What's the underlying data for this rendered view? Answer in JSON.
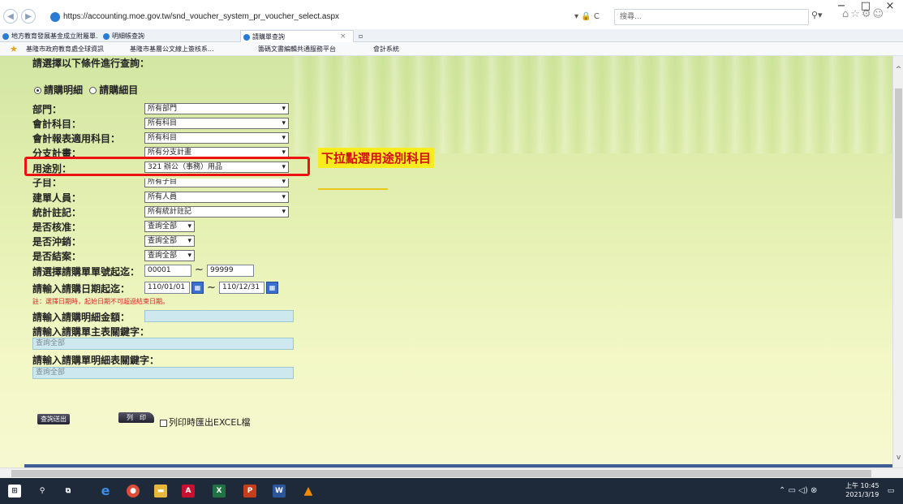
{
  "browser": {
    "url": "https://accounting.moe.gov.tw/snd_voucher_system_pr_voucher_select.aspx",
    "url_tools": "▾ 🔒 C",
    "search_placeholder": "搜尋...",
    "window_controls": [
      "−",
      "□",
      "×"
    ],
    "tabs": [
      {
        "label": "地方教育發展基金成立附屬單...",
        "active": false
      },
      {
        "label": "明細帳查詢",
        "active": false
      },
      {
        "label": "請購單查詢",
        "active": true
      }
    ],
    "favorites": [
      "基隆市政府教育處全球資訊",
      "基隆市基層公文線上簽核系...",
      "籌碼文書編輯共通服務平台",
      "會計系統"
    ]
  },
  "form": {
    "heading": "請選擇以下條件進行查詢：",
    "radio_detail": "請購明細",
    "radio_item": "請購細目",
    "fields": {
      "department": {
        "label": "部門：",
        "value": "所有部門"
      },
      "account": {
        "label": "會計科目：",
        "value": "所有科目"
      },
      "report_account": {
        "label": "會計報表適用科目：",
        "value": "所有科目"
      },
      "sub_plan": {
        "label": "分支計畫：",
        "value": "所有分支計畫"
      },
      "usage": {
        "label": "用途別：",
        "value": "321 辦公（事務）用品"
      },
      "sub_item": {
        "label": "子目：",
        "value": "所有子目"
      },
      "creator": {
        "label": "建單人員：",
        "value": "所有人員"
      },
      "stat_note": {
        "label": "統計註記：",
        "value": "所有統計註記"
      },
      "approved": {
        "label": "是否核准：",
        "value": "查詢全部"
      },
      "offset": {
        "label": "是否沖銷：",
        "value": "查詢全部"
      },
      "closed": {
        "label": "是否結案：",
        "value": "查詢全部"
      }
    },
    "number_range": {
      "label": "請選擇請購單單號起迄：",
      "from": "00001",
      "to": "99999"
    },
    "date_range": {
      "label": "請輸入請購日期起迄：",
      "from": "110/01/01",
      "to": "110/12/31"
    },
    "note": "註：選擇日期時，起始日期不可超過結束日期。",
    "amount_label": "請輸入請購明細金額：",
    "master_keyword_label": "請輸入請購單主表關鍵字：",
    "master_keyword_placeholder": "查詢全部",
    "detail_keyword_label": "請輸入請購單明細表關鍵字：",
    "detail_keyword_placeholder": "查詢全部",
    "query_button": "查詢送出",
    "print_button": "列　印",
    "export_checkbox": "列印時匯出EXCEL檔",
    "tilde": "~",
    "select_arrow": "▾"
  },
  "annotation": {
    "callout": "下拉點選用途別科目",
    "box_color": "#ee1111",
    "callout_bg": "#f8ec1e"
  },
  "taskbar": {
    "apps": [
      "Windows",
      "Search",
      "Task View",
      "Edge",
      "Chrome",
      "Files",
      "PDF",
      "Excel",
      "PowerPoint",
      "Word",
      "VLC"
    ],
    "time": "上午 10:45",
    "date": "2021/3/19"
  }
}
